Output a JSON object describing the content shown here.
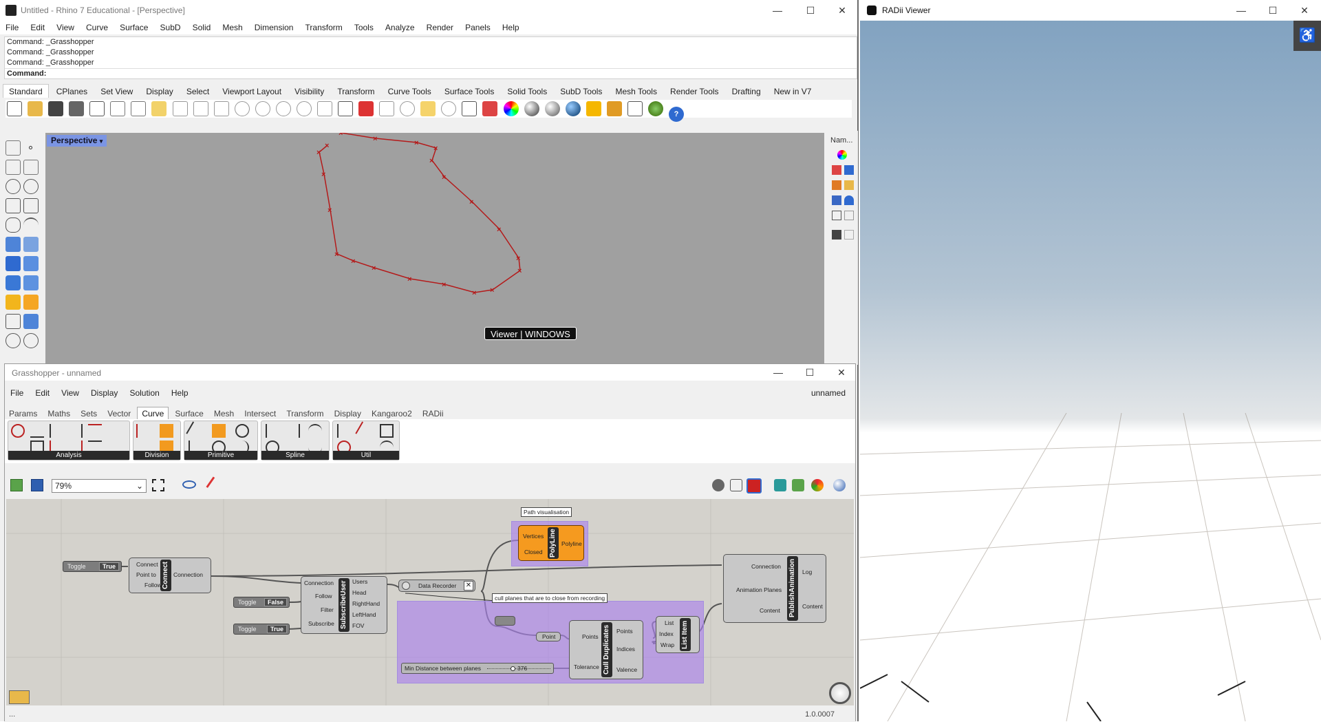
{
  "rhino": {
    "title": "Untitled - Rhino 7 Educational - [Perspective]",
    "menu": [
      "File",
      "Edit",
      "View",
      "Curve",
      "Surface",
      "SubD",
      "Solid",
      "Mesh",
      "Dimension",
      "Transform",
      "Tools",
      "Analyze",
      "Render",
      "Panels",
      "Help"
    ],
    "command_history": [
      "Command: _Grasshopper",
      "Command: _Grasshopper",
      "Command: _Grasshopper"
    ],
    "command_prompt": "Command:",
    "toolbar_tabs": [
      "Standard",
      "CPlanes",
      "Set View",
      "Display",
      "Select",
      "Viewport Layout",
      "Visibility",
      "Transform",
      "Curve Tools",
      "Surface Tools",
      "Solid Tools",
      "SubD Tools",
      "Mesh Tools",
      "Render Tools",
      "Drafting",
      "New in V7"
    ],
    "active_tab": "Standard",
    "viewport_label": "Perspective",
    "viewport_overlay": "Viewer | WINDOWS",
    "right_panel_label": "Nam..."
  },
  "grasshopper": {
    "title": "Grasshopper - unnamed",
    "menu": [
      "File",
      "Edit",
      "View",
      "Display",
      "Solution",
      "Help"
    ],
    "doc_name": "unnamed",
    "tabs": [
      "Params",
      "Maths",
      "Sets",
      "Vector",
      "Curve",
      "Surface",
      "Mesh",
      "Intersect",
      "Transform",
      "Display",
      "Kangaroo2",
      "RADii"
    ],
    "active_tab": "Curve",
    "ribbon_groups": [
      "Analysis",
      "Division",
      "Primitive",
      "Spline",
      "Util"
    ],
    "zoom": "79%",
    "version": "1.0.0007",
    "status_left": "...",
    "components": {
      "toggle1": {
        "label": "Toggle",
        "value": "True"
      },
      "toggle2": {
        "label": "Toggle",
        "value": "False"
      },
      "toggle3": {
        "label": "Toggle",
        "value": "True"
      },
      "connect": {
        "name": "Connect",
        "inputs": [
          "Connect",
          "Point to",
          "Follow"
        ],
        "outputs": [
          "Connection"
        ]
      },
      "subscribe": {
        "name": "SubscribeUser",
        "inputs": [
          "Connection",
          "Follow",
          "Filter",
          "Subscribe"
        ],
        "outputs": [
          "Users",
          "Head",
          "RightHand",
          "LeftHand",
          "FOV"
        ]
      },
      "recorder": {
        "name": "Data Recorder"
      },
      "polyline": {
        "name": "PolyLine",
        "inputs": [
          "Vertices",
          "Closed"
        ],
        "outputs": [
          "Polyline"
        ]
      },
      "path_note": "Path visualisation",
      "cull_note": "cull planes that are to close from recording",
      "point": "Point",
      "cull_dup": {
        "name": "Cull Duplicates",
        "inputs": [
          "Points",
          "Tolerance"
        ],
        "outputs": [
          "Points",
          "Indices",
          "Valence"
        ]
      },
      "list_item": {
        "name": "List Item",
        "inputs": [
          "List",
          "Index",
          "Wrap"
        ]
      },
      "slider": {
        "label": "Min Distance between planes",
        "value": "376"
      },
      "publish": {
        "name": "PublishAnimation",
        "inputs": [
          "Connection",
          "Animation Planes",
          "Content"
        ],
        "outputs": [
          "Log",
          "Content"
        ]
      }
    }
  },
  "radii": {
    "title": "RADii Viewer"
  },
  "colors": {
    "viewport_bg": "#a0a0a0",
    "curve": "#b41a1a",
    "orange": "#f59a1f",
    "group": "#b08ce8"
  }
}
